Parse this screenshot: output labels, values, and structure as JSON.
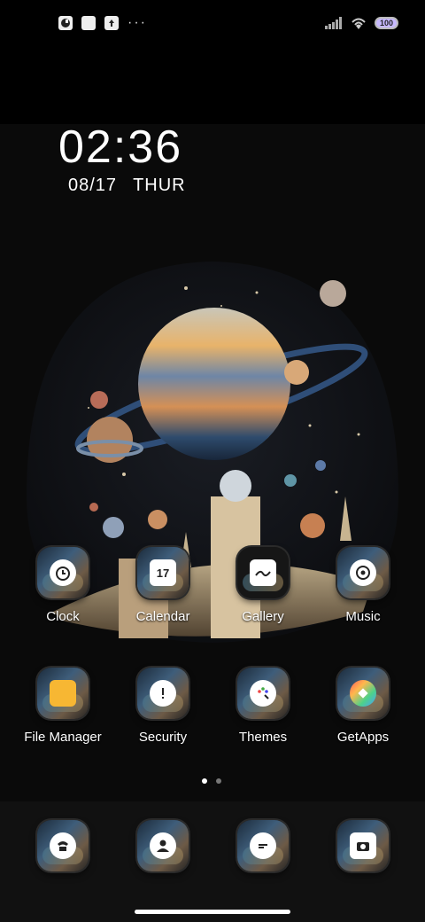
{
  "statusbar": {
    "left_icons": [
      "app-notification-icon",
      "square-notification-icon",
      "upload-notification-icon"
    ],
    "more": "···",
    "battery_level": "100",
    "signal_icon": "signal-icon",
    "wifi_icon": "wifi-icon"
  },
  "clock": {
    "time": "02:36",
    "date": "08/17",
    "day": "THUR"
  },
  "apps_row1": [
    {
      "label": "Clock",
      "icon": "alarm-clock-icon"
    },
    {
      "label": "Calendar",
      "icon": "calendar-icon"
    },
    {
      "label": "Gallery",
      "icon": "gallery-icon"
    },
    {
      "label": "Music",
      "icon": "music-disc-icon"
    }
  ],
  "apps_row2": [
    {
      "label": "File Manager",
      "icon": "folder-icon"
    },
    {
      "label": "Security",
      "icon": "shield-icon"
    },
    {
      "label": "Themes",
      "icon": "palette-icon"
    },
    {
      "label": "GetApps",
      "icon": "getapps-icon"
    }
  ],
  "calendar_day": "17",
  "dock": [
    {
      "name": "phone",
      "icon": "phone-icon"
    },
    {
      "name": "contacts",
      "icon": "contacts-icon"
    },
    {
      "name": "messages",
      "icon": "message-icon"
    },
    {
      "name": "camera",
      "icon": "camera-icon"
    }
  ],
  "page_indicator": {
    "pages": 2,
    "current": 1
  },
  "colors": {
    "background": "#0a0a0a",
    "accent": "#c7b9ff",
    "planet": "#e8b36a",
    "sky": "#101318"
  }
}
